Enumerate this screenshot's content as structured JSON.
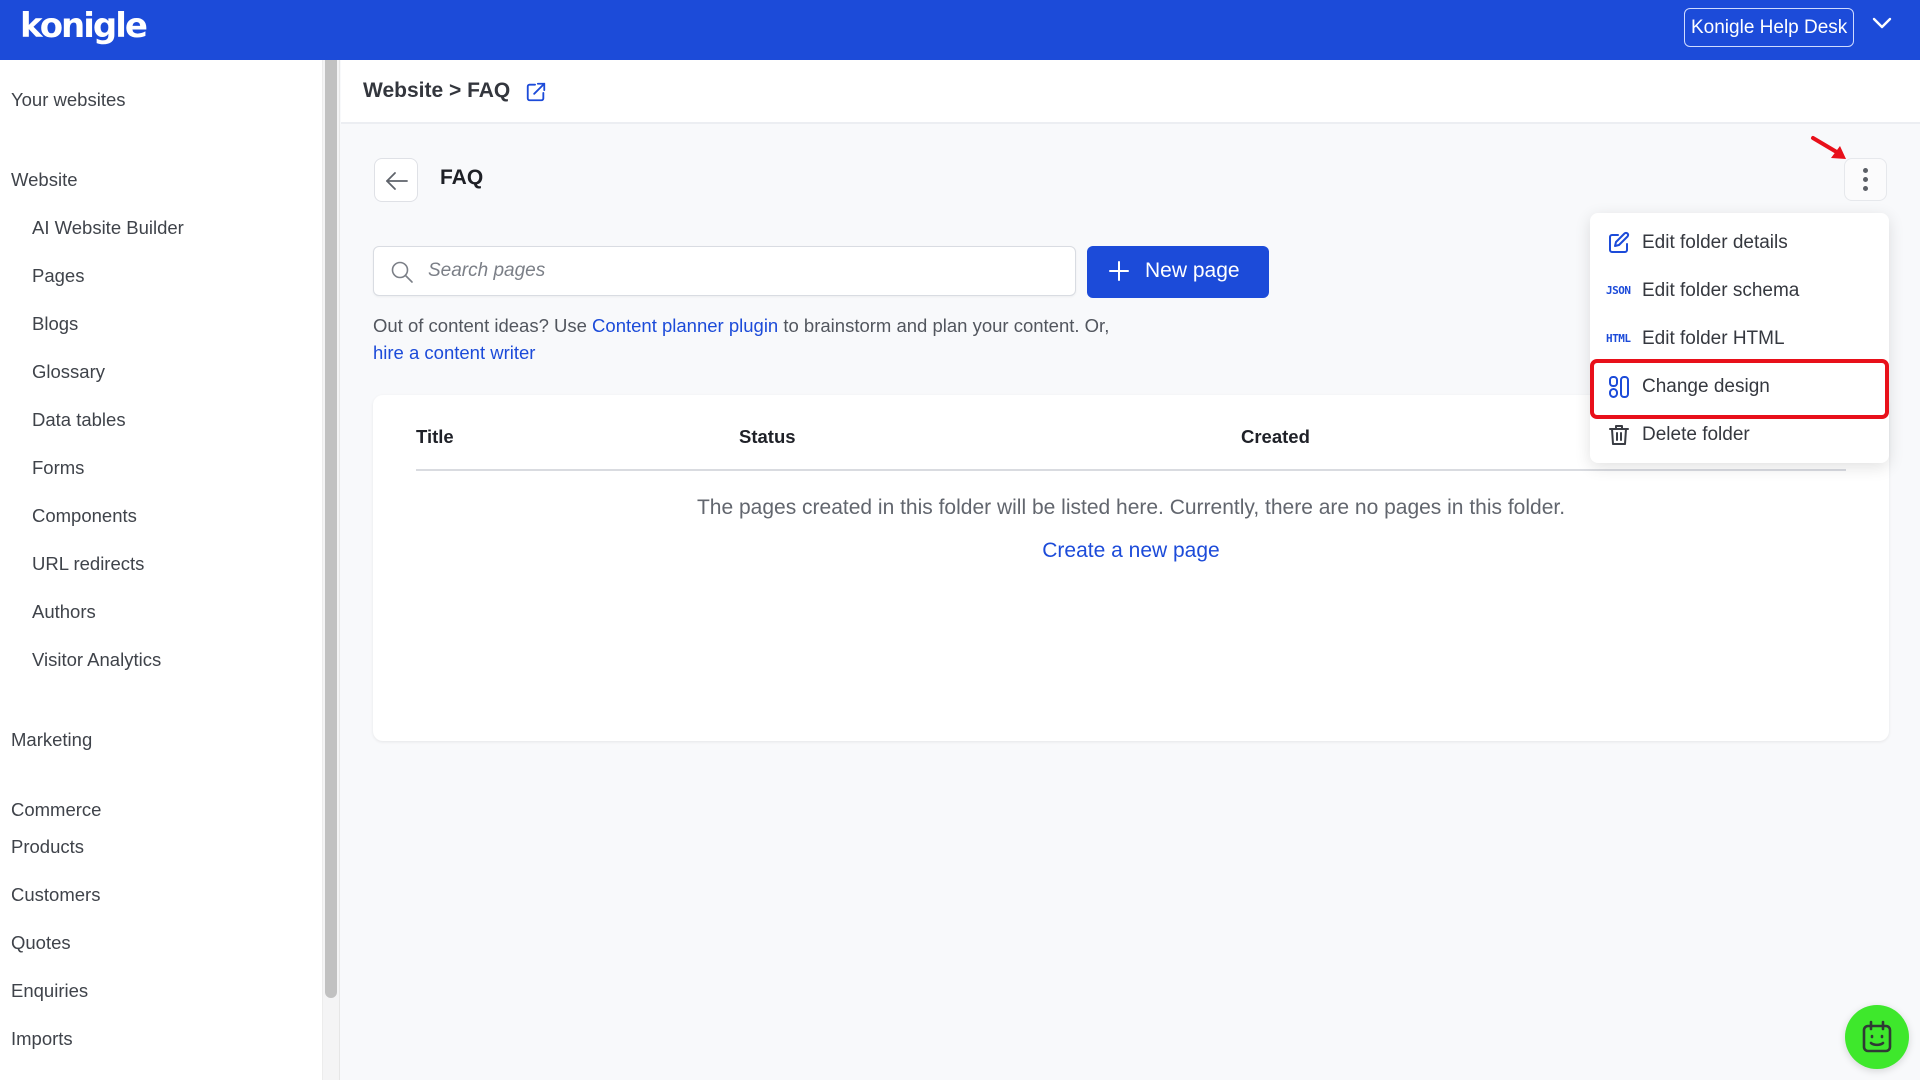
{
  "app": {
    "logo": "konigle",
    "brand_color": "#1c4bd9",
    "help_desk_label": "Konigle Help Desk"
  },
  "sidebar": {
    "your_websites": "Your websites",
    "website_section": "Website",
    "website_items": [
      "AI Website Builder",
      "Pages",
      "Blogs",
      "Glossary",
      "Data tables",
      "Forms",
      "Components",
      "URL redirects",
      "Authors",
      "Visitor Analytics"
    ],
    "marketing_section": "Marketing",
    "commerce_section": "Commerce",
    "commerce_items": [
      "Products",
      "Customers",
      "Quotes",
      "Enquiries",
      "Imports"
    ]
  },
  "breadcrumb": {
    "text": "Website > FAQ"
  },
  "folder": {
    "title": "FAQ"
  },
  "search": {
    "placeholder": "Search pages",
    "value": ""
  },
  "toolbar": {
    "new_page_label": "New page"
  },
  "helper": {
    "prefix": "Out of content ideas? Use ",
    "plugin_link": "Content planner plugin",
    "middle": " to brainstorm and plan your content. Or,",
    "writer_link": "hire a content writer"
  },
  "table": {
    "columns": [
      "Title",
      "Status",
      "Created"
    ],
    "rows": [],
    "empty_message": "The pages created in this folder will be listed here. Currently, there are no pages in this folder.",
    "create_link": "Create a new page"
  },
  "menu": {
    "items": [
      {
        "label": "Edit folder details",
        "icon": "edit-icon"
      },
      {
        "label": "Edit folder schema",
        "icon": "json-icon",
        "icon_text": "JSON"
      },
      {
        "label": "Edit folder HTML",
        "icon": "html-icon",
        "icon_text": "HTML"
      },
      {
        "label": "Change design",
        "icon": "layout-icon",
        "highlighted": true
      },
      {
        "label": "Delete folder",
        "icon": "trash-icon"
      }
    ],
    "highlight_color": "#e8101a"
  },
  "chat": {
    "color": "#3ee82c"
  }
}
